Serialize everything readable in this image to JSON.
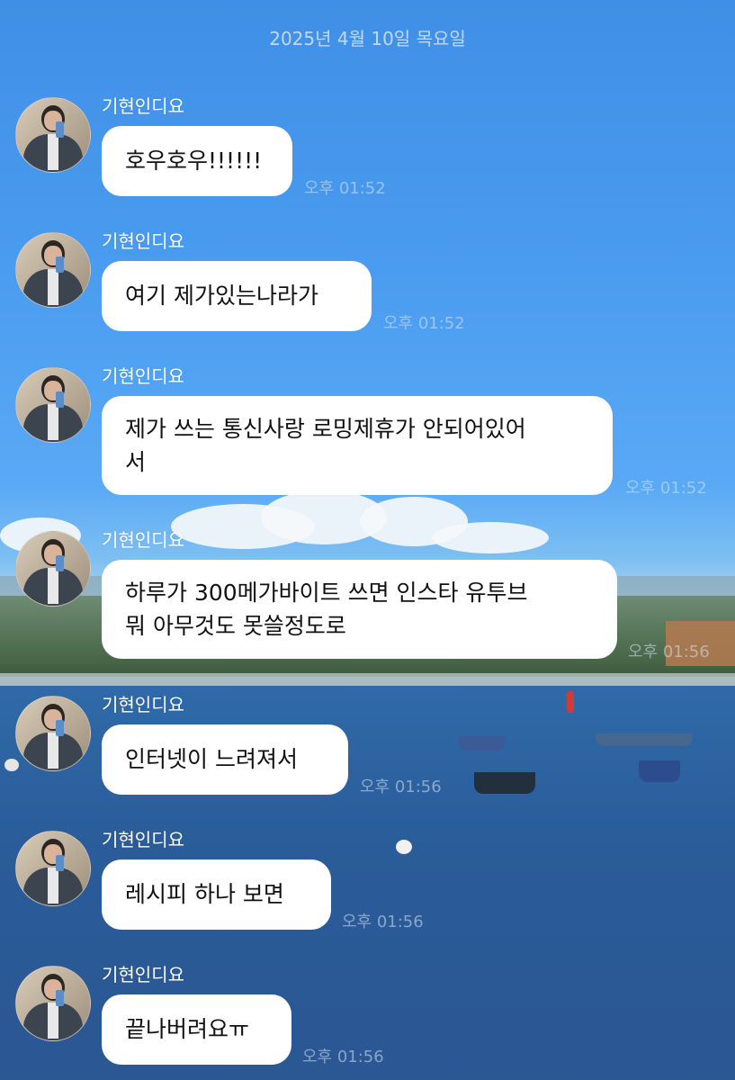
{
  "date_header": "2025년 4월 10일 목요일",
  "messages": [
    {
      "sender": "기현인디요",
      "text": "호우호우!!!!!!",
      "time": "오후 01:52"
    },
    {
      "sender": "기현인디요",
      "text": "여기 제가있는나라가",
      "time": "오후 01:52"
    },
    {
      "sender": "기현인디요",
      "text": "제가 쓰는 통신사랑 로밍제휴가 안되어있어\n서",
      "time": "오후 01:52"
    },
    {
      "sender": "기현인디요",
      "text": "하루가 300메가바이트 쓰면 인스타 유투브\n뭐 아무것도 못쓸정도로",
      "time": "오후 01:56"
    },
    {
      "sender": "기현인디요",
      "text": "인터넷이 느려져서",
      "time": "오후 01:56"
    },
    {
      "sender": "기현인디요",
      "text": "레시피 하나 보면",
      "time": "오후 01:56"
    },
    {
      "sender": "기현인디요",
      "text": "끝나버려요ㅠ",
      "time": "오후 01:56"
    }
  ]
}
